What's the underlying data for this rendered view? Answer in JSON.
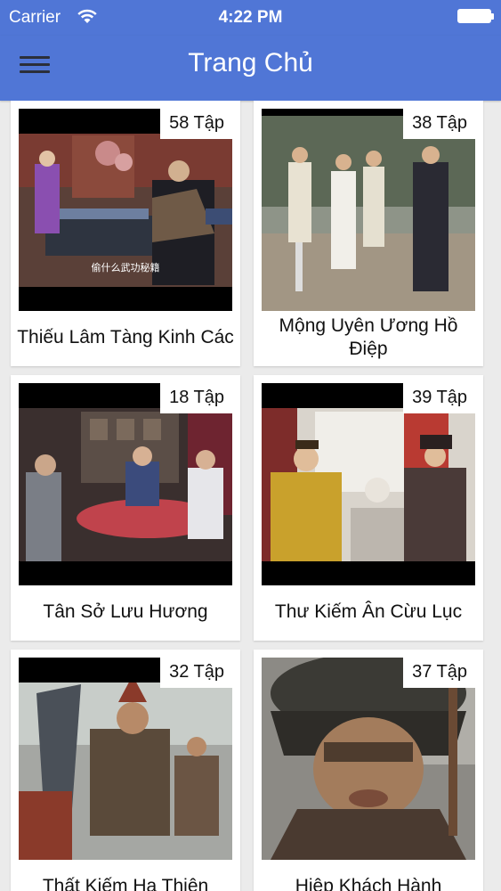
{
  "status_bar": {
    "carrier": "Carrier",
    "time": "4:22 PM"
  },
  "nav": {
    "title": "Trang Chủ",
    "menu_icon": "hamburger-menu-icon"
  },
  "items": [
    {
      "title": "Thiếu Lâm Tàng Kinh Các",
      "episodes": "58 Tập",
      "subtitle": "偷什么武功秘籍"
    },
    {
      "title": "Mộng Uyên Ương Hồ Điệp",
      "episodes": "38 Tập",
      "subtitle": ""
    },
    {
      "title": "Tân Sở Lưu Hương",
      "episodes": "18 Tập",
      "subtitle": ""
    },
    {
      "title": "Thư Kiếm Ân Cừu Lục",
      "episodes": "39 Tập",
      "subtitle": ""
    },
    {
      "title": "Thất Kiếm Hạ Thiên",
      "episodes": "32 Tập",
      "subtitle": ""
    },
    {
      "title": "Hiệp Khách Hành",
      "episodes": "37 Tập",
      "subtitle": ""
    }
  ]
}
